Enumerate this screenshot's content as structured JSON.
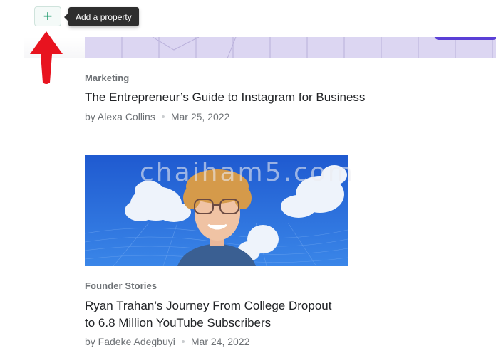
{
  "toolbar": {
    "add_icon": "plus-icon",
    "add_glyph": "+",
    "tooltip": "Add a property"
  },
  "annotation": {
    "arrow_icon": "red-arrow-up-icon",
    "color": "#e8131f"
  },
  "articles": [
    {
      "category": "Marketing",
      "title": "The Entrepreneur’s Guide to Instagram for Business",
      "author": "by Alexa Collins",
      "date": "Mar 25, 2022"
    },
    {
      "category": "Founder Stories",
      "title_line1": "Ryan Trahan’s Journey From College Dropout",
      "title_line2": "to 6.8 Million YouTube Subscribers",
      "author": "by Fadeke Adegbuyi",
      "date": "Mar 24, 2022"
    }
  ],
  "watermark": "chaiham5.com",
  "colors": {
    "accent_green": "#1d9a6c",
    "image_lavender": "#dcd6f2",
    "sky_blue": "#2b6fd6"
  }
}
